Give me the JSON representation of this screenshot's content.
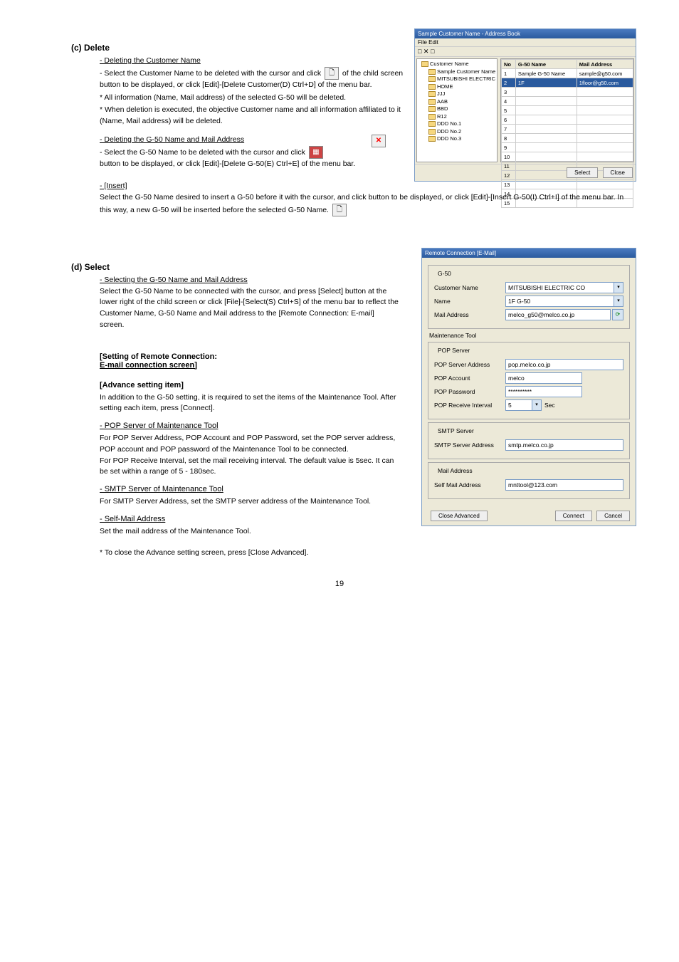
{
  "section1": {
    "heading": "(c) Delete",
    "sub1": "- Deleting the Customer Name",
    "item1a": "- Select the Customer Name to be deleted with the cursor and click",
    "newIconNote": "of the child screen",
    "item1b": "button to be displayed, or click [Edit]-[Delete Customer(D) Ctrl+D] of the menu bar.",
    "caution1": "* All information (Name, Mail address) of the selected G-50 will be deleted.",
    "caution2": "* When deletion is executed, the objective Customer name and all information affiliated to it (Name, Mail address) will be deleted.",
    "sub2": "- Deleting the G-50 Name and Mail Address",
    "item2a": "- Select the G-50 Name to be deleted with the cursor and click",
    "item2b": "button to be displayed, or click [Edit]-[Delete G-50(E) Ctrl+E] of the menu bar.",
    "sub3": "- [Insert]",
    "insertText": "Select the G-50 Name desired to insert a G-50 before it with the cursor, and click button to be displayed, or click [Edit]-[Insert G-50(I) Ctrl+I] of the menu bar. In this way, a new G-50 will be inserted before the selected G-50 Name."
  },
  "addressBook": {
    "title": "Sample Customer Name - Address Book",
    "menu": "File  Edit",
    "toolIcons": "□ ✕ □",
    "treeRoot": "Customer Name",
    "treeItems": [
      "Sample Customer Name",
      "MITSUBISHI ELECTRIC CO",
      "HOME",
      "JJJ",
      "AAB",
      "BBD",
      "R12",
      "DDD No.1",
      "DDD No.2",
      "DDD No.3"
    ],
    "colNo": "No",
    "colName": "G-50 Name",
    "colMail": "Mail Address",
    "rows": [
      {
        "no": "1",
        "name": "Sample G-50 Name",
        "mail": "sample@g50.com"
      },
      {
        "no": "2",
        "name": "1F",
        "mail": "1floor@g50.com"
      }
    ],
    "btnSelect": "Select",
    "btnClose": "Close"
  },
  "section2": {
    "heading": "(d) Select",
    "sub1": "- Selecting the G-50 Name and Mail Address",
    "text1": "Select the G-50 Name to be connected with the cursor, and press [Select] button at the lower right of the child screen or click [File]-[Select(S) Ctrl+S] of the menu bar to reflect the Customer Name, G-50 Name and Mail address to the [Remote Connection: E-mail] screen.",
    "bracket1": "[Setting of Remote Connection:",
    "underline1": "E-mail connection screen]",
    "bracket2": "[Advance setting item]",
    "advText": "In addition to the G-50 setting, it is required to set the items of the Maintenance Tool. After setting each item, press [Connect].",
    "sub2": "- POP Server of Maintenance Tool",
    "popText": "For POP Server Address, POP Account and POP Password, set the POP server address, POP account and POP password of the Maintenance Tool to be connected.\nFor POP Receive Interval, set the mail receiving interval. The default value is 5sec. It can be set within a range of 5 - 180sec.",
    "sub3": "- SMTP Server of Maintenance Tool",
    "smtpText": "For SMTP Server Address, set the SMTP server address of the Maintenance Tool.",
    "sub4": "- Self-Mail Address",
    "mailText": "Set the mail address of the Maintenance Tool.",
    "closeNote": "* To close the Advance setting screen, press [Close Advanced]."
  },
  "connDialog": {
    "title": "Remote Connection [E-Mail]",
    "g50Legend": "G-50",
    "lblCustomer": "Customer Name",
    "valCustomer": "MITSUBISHI ELECTRIC CO",
    "lblName": "Name",
    "valName": "1F G-50",
    "lblMail": "Mail Address",
    "valMail": "melco_g50@melco.co.jp",
    "mtLegend": "Maintenance Tool",
    "popLegend": "POP Server",
    "lblPopAddr": "POP Server Address",
    "valPopAddr": "pop.melco.co.jp",
    "lblPopAcct": "POP Account",
    "valPopAcct": "melco",
    "lblPopPass": "POP Password",
    "valPopPass": "**********",
    "lblPopInt": "POP Receive Interval",
    "valPopInt": "5",
    "secLabel": "Sec",
    "smtpLegend": "SMTP Server",
    "lblSmtpAddr": "SMTP Server Address",
    "valSmtpAddr": "smtp.melco.co.jp",
    "mailLegend": "Mail Address",
    "lblSelfMail": "Self Mail Address",
    "valSelfMail": "mnttool@123.com",
    "btnCloseAdv": "Close Advanced",
    "btnConnect": "Connect",
    "btnCancel": "Cancel"
  },
  "pageNum": "19"
}
